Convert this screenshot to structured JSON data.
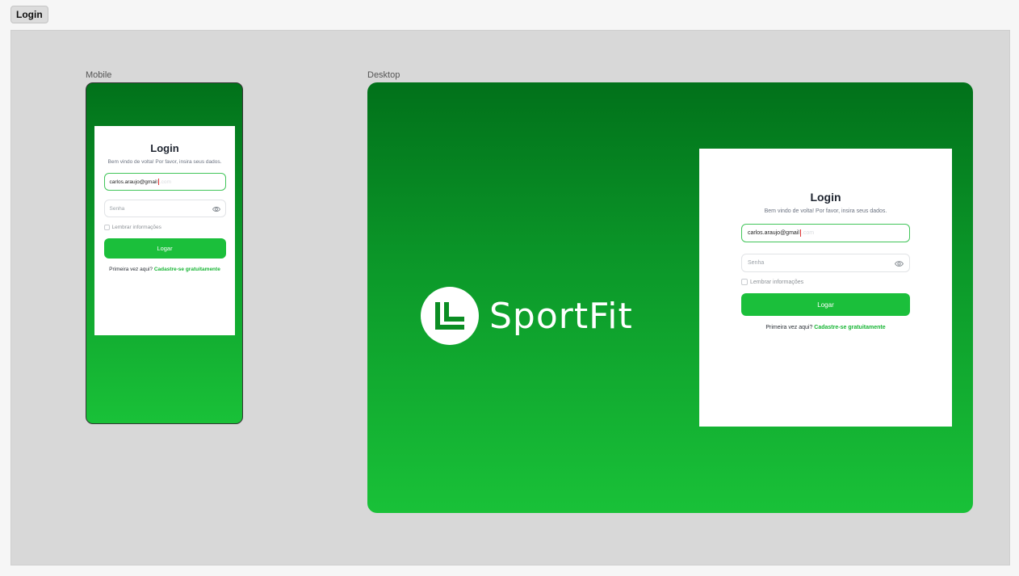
{
  "top_tab": {
    "label": "Login"
  },
  "colors": {
    "brand_green": "#1bbf3b",
    "dark_green": "#01711a",
    "link_green": "#17b534",
    "canvas": "#d8d8d8"
  },
  "mobile": {
    "frame_label": "Mobile",
    "card": {
      "title": "Login",
      "subtitle": "Bem vindo de volta! Por favor, insira seus dados.",
      "email_value": "carlos.araujo@gmail",
      "email_suggestion": ".com",
      "password_placeholder": "Senha",
      "password_icon": "eye-icon",
      "remember_label": "Lembrar informações",
      "submit_label": "Logar",
      "signup_prompt": "Primeira vez aqui?",
      "signup_link": "Cadastre-se gratuitamente"
    }
  },
  "desktop": {
    "frame_label": "Desktop",
    "brand": {
      "name": "SportFit",
      "logo_icon": "sportfit-logo-icon"
    },
    "card": {
      "title": "Login",
      "subtitle": "Bem vindo de volta! Por favor, insira seus dados.",
      "email_value": "carlos.araujo@gmail",
      "email_suggestion": ".com",
      "password_placeholder": "Senha",
      "password_icon": "eye-icon",
      "remember_label": "Lembrar informações",
      "submit_label": "Logar",
      "signup_prompt": "Primeira vez aqui?",
      "signup_link": "Cadastre-se gratuitamente"
    }
  }
}
